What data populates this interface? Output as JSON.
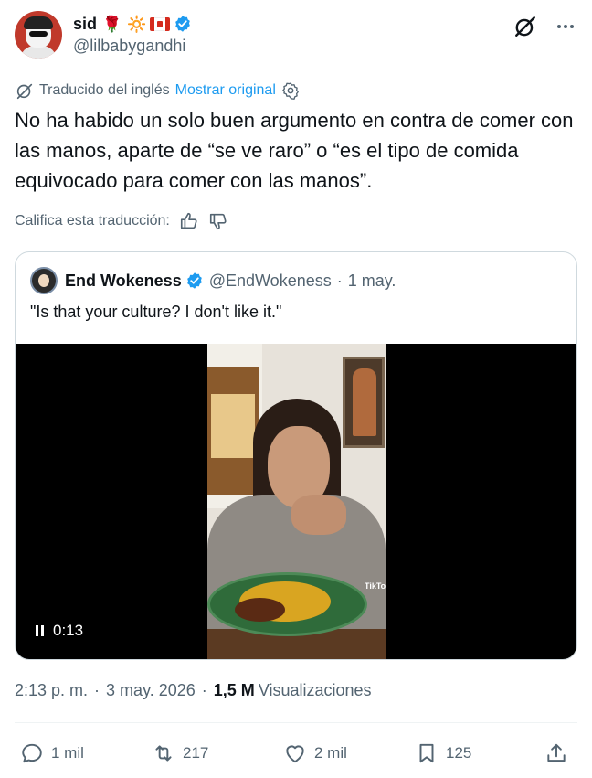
{
  "author": {
    "display_name": "sid",
    "emojis": [
      "🌹",
      "🔆"
    ],
    "handle": "@lilbabygandhi"
  },
  "translation": {
    "label": "Traducido del inglés",
    "show_original": "Mostrar original",
    "rate_label": "Califica esta traducción:"
  },
  "tweet_text": "No ha habido un solo buen argumento en contra de comer con las manos, aparte de “se ve raro” o “es el tipo de comida equivocado para comer con las manos”.",
  "quote": {
    "display_name": "End Wokeness",
    "handle": "@EndWokeness",
    "date": "1 may.",
    "text": "\"Is that your culture? I don't like it.\"",
    "video_time": "0:13",
    "watermark": "TikTok"
  },
  "meta": {
    "time": "2:13 p. m.",
    "date": "3 may. 2026",
    "views_count": "1,5 M",
    "views_label": "Visualizaciones"
  },
  "actions": {
    "replies": "1 mil",
    "reposts": "217",
    "likes": "2 mil",
    "bookmarks": "125"
  },
  "colors": {
    "accent": "#1d9bf0",
    "secondary_text": "#536471",
    "primary_text": "#0f1419",
    "border": "#cfd9de"
  }
}
